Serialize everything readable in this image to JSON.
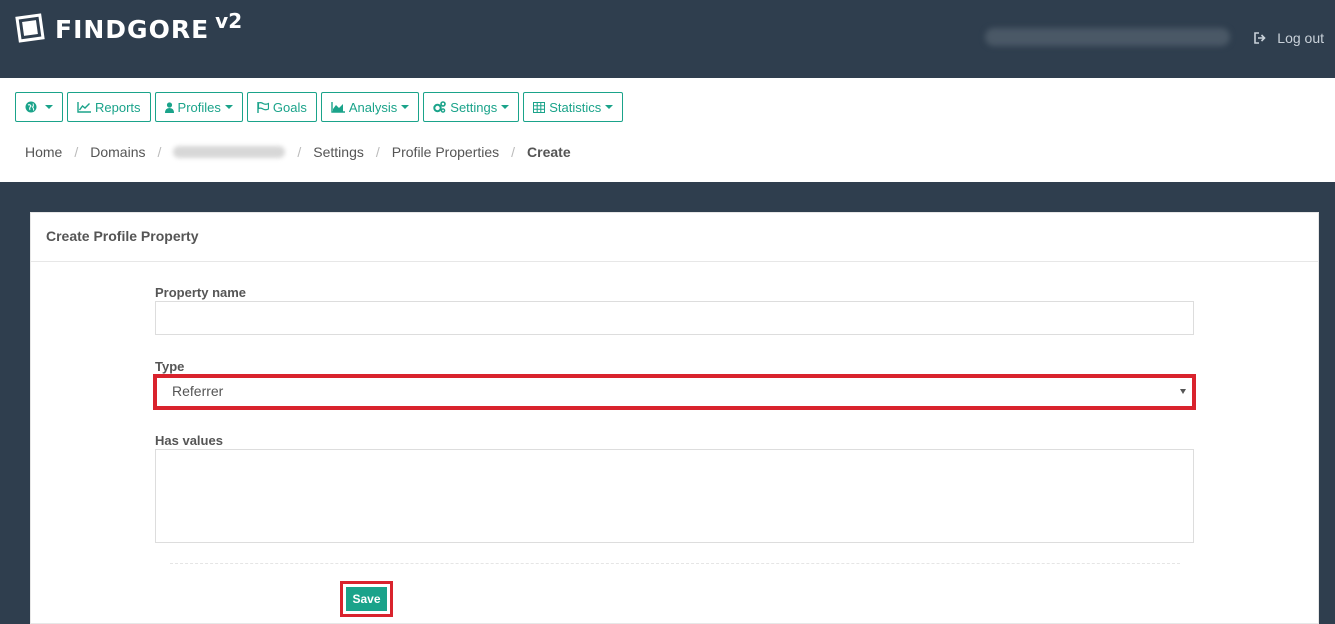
{
  "app": {
    "name": "FINDGORE",
    "version": "v2"
  },
  "header": {
    "logout_label": "Log out"
  },
  "nav": {
    "globe_label": "",
    "reports_label": "Reports",
    "profiles_label": "Profiles",
    "goals_label": "Goals",
    "analysis_label": "Analysis",
    "settings_label": "Settings",
    "statistics_label": "Statistics"
  },
  "breadcrumb": {
    "home": "Home",
    "domains": "Domains",
    "settings": "Settings",
    "profile_properties": "Profile Properties",
    "current": "Create",
    "separator": "/"
  },
  "form": {
    "title": "Create Profile Property",
    "property_name_label": "Property name",
    "property_name_value": "",
    "type_label": "Type",
    "type_selected": "Referrer",
    "has_values_label": "Has values",
    "has_values_value": "",
    "save_label": "Save"
  },
  "colors": {
    "header_bg": "#2f3e4e",
    "accent": "#1aa38a",
    "highlight": "#d9232d"
  }
}
